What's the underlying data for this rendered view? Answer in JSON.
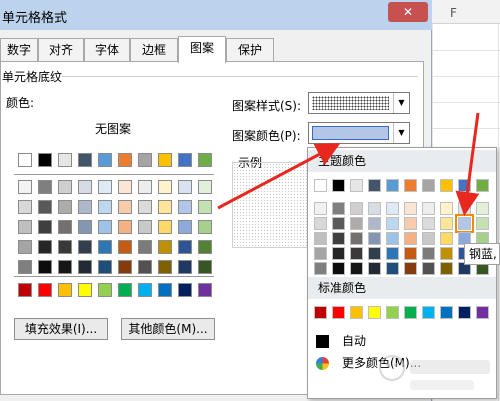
{
  "dialog": {
    "title": "单元格格式",
    "close_glyph": "✕",
    "tabs": [
      "数字",
      "对齐",
      "字体",
      "边框",
      "图案",
      "保护"
    ],
    "active_tab": "图案"
  },
  "section": {
    "title": "单元格底纹",
    "color_label": "颜色:",
    "no_pattern_label": "无图案",
    "fill_effects_button": "填充效果(I)...",
    "more_colors_button": "其他颜色(M)..."
  },
  "pattern": {
    "style_label": "图案样式(S):",
    "color_label": "图案颜色(P):",
    "sample_label": "示例",
    "selected_color": "#b4c6e7"
  },
  "palette_popup": {
    "theme_header": "主题颜色",
    "standard_header": "标准颜色",
    "auto_label": "自动",
    "more_colors_label": "更多颜色(M)...",
    "tooltip": "钢蓝,"
  },
  "sheet": {
    "column_header": "F"
  },
  "colors": {
    "theme_top": [
      "#ffffff",
      "#000000",
      "#e7e6e6",
      "#44546a",
      "#5b9bd5",
      "#ed7d31",
      "#a5a5a5",
      "#ffc000",
      "#4472c4",
      "#70ad47"
    ],
    "theme_tints": [
      [
        "#f2f2f2",
        "#7f7f7f",
        "#d0cece",
        "#d6dce4",
        "#deebf6",
        "#fbe5d5",
        "#ededed",
        "#fff2cc",
        "#d9e2f3",
        "#e2efd9"
      ],
      [
        "#d8d8d8",
        "#595959",
        "#aeabab",
        "#adb9ca",
        "#bdd7ee",
        "#f7cbac",
        "#dbdbdb",
        "#fee599",
        "#b4c6e7",
        "#c5e0b3"
      ],
      [
        "#bfbfbf",
        "#3f3f3f",
        "#757070",
        "#8496b0",
        "#9dc3e6",
        "#f4b183",
        "#c9c9c9",
        "#ffd965",
        "#8eaadb",
        "#a8d08d"
      ],
      [
        "#a5a5a5",
        "#262626",
        "#3a3838",
        "#323f4f",
        "#2e75b5",
        "#c55a11",
        "#7b7b7b",
        "#bf9000",
        "#2f5496",
        "#538135"
      ],
      [
        "#7f7f7f",
        "#0c0c0c",
        "#171616",
        "#222a35",
        "#1e4e79",
        "#843c0c",
        "#525252",
        "#7f6000",
        "#1f3864",
        "#375623"
      ]
    ],
    "standard": [
      "#c00000",
      "#ff0000",
      "#ffc000",
      "#ffff00",
      "#92d050",
      "#00b050",
      "#00b0f0",
      "#0070c0",
      "#002060",
      "#7030a0"
    ],
    "arrow": "#e8281e"
  }
}
